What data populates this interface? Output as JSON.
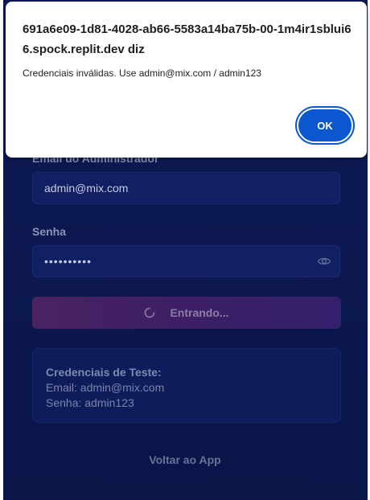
{
  "login": {
    "email_label": "Email do Administrador",
    "email_value": "admin@mix.com",
    "password_label": "Senha",
    "password_value": "••••••••••",
    "submit_label": "Entrando...",
    "back_label": "Voltar ao App"
  },
  "test_credentials": {
    "title": "Credenciais de Teste:",
    "email_line": "Email: admin@mix.com",
    "password_line": "Senha: admin123"
  },
  "alert": {
    "origin": "691a6e09-1d81-4028-ab66-5583a14ba75b-00-1m4ir1sblui66.spock.replit.dev diz",
    "message": "Credenciais inválidas. Use admin@mix.com / admin123",
    "ok_label": "OK"
  },
  "icons": {
    "password_toggle": "eye-icon",
    "loading": "spinner-icon"
  },
  "colors": {
    "page_background": "#0c1950",
    "button_gradient_start": "#4a2262",
    "button_gradient_end": "#33206c",
    "alert_button": "#0b57d0"
  }
}
